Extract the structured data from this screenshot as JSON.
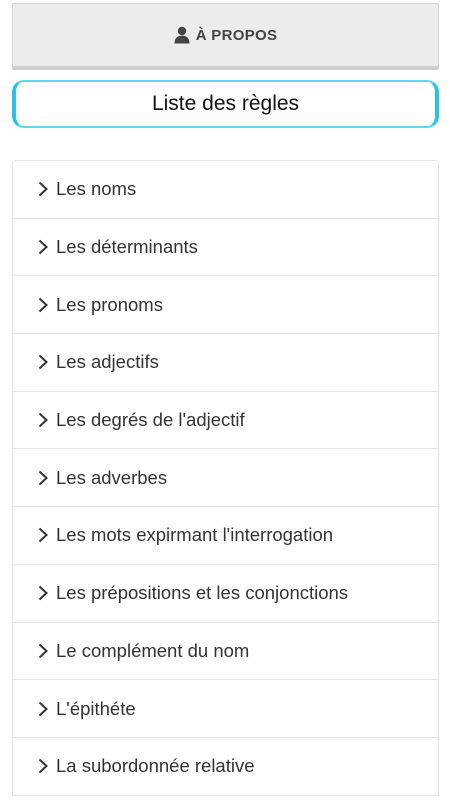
{
  "about": {
    "icon": "user-icon",
    "label": "À PROPOS"
  },
  "list_title": "Liste des règles",
  "rules": [
    {
      "label": "Les noms",
      "icon": "chevron-right-icon"
    },
    {
      "label": "Les déterminants",
      "icon": "chevron-right-icon"
    },
    {
      "label": "Les pronoms",
      "icon": "chevron-right-icon"
    },
    {
      "label": "Les adjectifs",
      "icon": "chevron-right-icon"
    },
    {
      "label": "Les degrés de l'adjectif",
      "icon": "chevron-right-icon"
    },
    {
      "label": "Les adverbes",
      "icon": "chevron-right-icon"
    },
    {
      "label": "Les mots expirmant l'interrogation",
      "icon": "chevron-right-icon"
    },
    {
      "label": "Les prépositions et les conjonctions",
      "icon": "chevron-right-icon"
    },
    {
      "label": "Le complément du nom",
      "icon": "chevron-right-icon"
    },
    {
      "label": "L'épithéte",
      "icon": "chevron-right-icon"
    },
    {
      "label": "La subordonnée relative",
      "icon": "chevron-right-icon"
    }
  ],
  "colors": {
    "accent": "#29c3ea",
    "button_bg": "#ececec",
    "text": "#333333"
  }
}
